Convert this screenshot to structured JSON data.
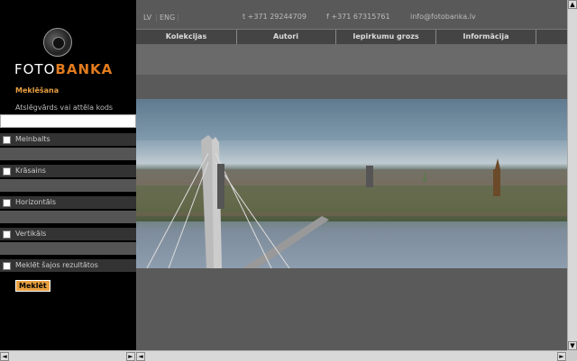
{
  "header": {
    "lang_lv": "LV",
    "lang_eng": "ENG",
    "phone": "t +371 29244709",
    "fax": "f +371 67315761",
    "email": "info@fotobanka.lv"
  },
  "logo": {
    "part1": "FOTO",
    "part2": "BANKA"
  },
  "nav": {
    "items": [
      "Kolekcijas",
      "Autori",
      "Iepirkumu grozs",
      "Informācija"
    ]
  },
  "search": {
    "title": "Meklēšana",
    "hint": "Atslēgvārds vai attēla kods",
    "input_value": "",
    "filters": [
      "Melnbalts",
      "Krāsains",
      "Horizontāls",
      "Vertikāls",
      "Meklēt šajos rezultātos"
    ],
    "button": "Meklēt"
  },
  "scrollbars": {
    "up": "▲",
    "down": "▼",
    "left": "◄",
    "right": "►"
  },
  "colors": {
    "accent": "#e27b1d",
    "sidebar": "#000000",
    "panel": "#5a5a5a"
  }
}
